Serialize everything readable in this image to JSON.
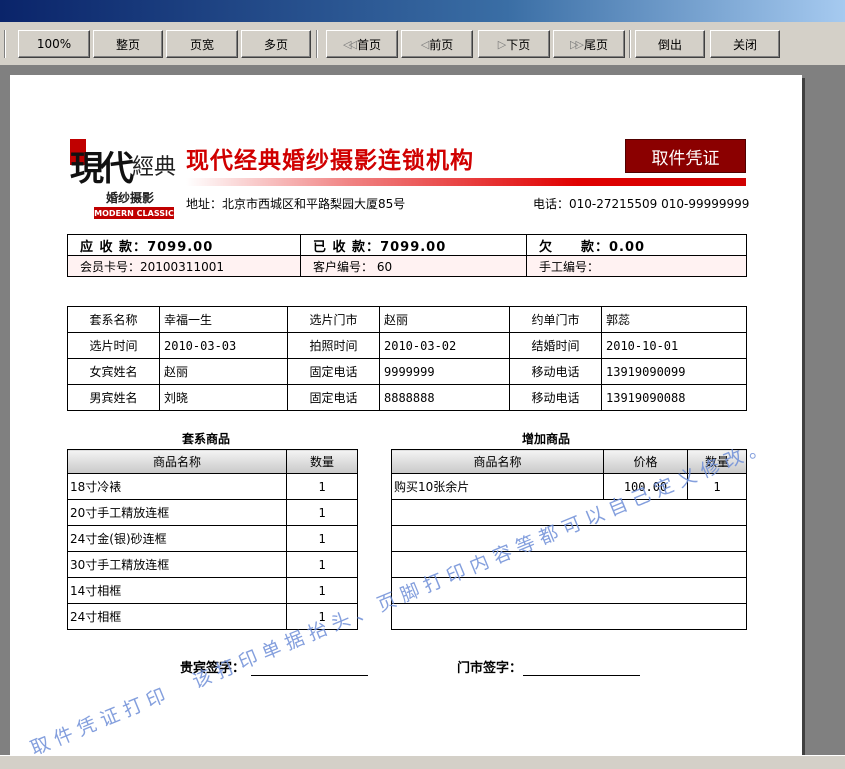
{
  "toolbar": {
    "buttons": [
      "100%",
      "整页",
      "页宽",
      "多页",
      "首页",
      "前页",
      "下页",
      "尾页",
      "倒出",
      "关闭"
    ]
  },
  "slip": {
    "logo_text": "婚纱摄影",
    "logo_sub": "MODERN CLASSIC",
    "company": "现代经典婚纱摄影连锁机构",
    "badge": "取件凭证",
    "address": "地址：北京市西城区和平路梨园大厦85号",
    "phone": "电话：010-27215509 010-99999999"
  },
  "summary": {
    "receivable_label": "应 收 款：",
    "receivable_value": "7099.00",
    "received_label": "已 收 款：",
    "received_value": "7099.00",
    "owed_label": "欠　　款：",
    "owed_value": "0.00",
    "member_card": "会员卡号：20100311001",
    "customer_no": "客户编号： 60",
    "manual_no": "手工编号："
  },
  "info": {
    "rows": [
      [
        "套系名称",
        "幸福一生",
        "选片门市",
        "赵丽",
        "约单门市",
        "郭蕊"
      ],
      [
        "选片时间",
        "2010-03-03",
        "拍照时间",
        "2010-03-02",
        "结婚时间",
        "2010-10-01"
      ],
      [
        "女宾姓名",
        "赵丽",
        "固定电话",
        "9999999",
        "移动电话",
        "13919090099"
      ],
      [
        "男宾姓名",
        "刘晓",
        "固定电话",
        "8888888",
        "移动电话",
        "13919090088"
      ]
    ]
  },
  "package_goods": {
    "title": "套系商品",
    "headers": [
      "商品名称",
      "数量"
    ],
    "rows": [
      [
        "18寸冷裱",
        "1"
      ],
      [
        "20寸手工精放连框",
        "1"
      ],
      [
        "24寸金(银)砂连框",
        "1"
      ],
      [
        "30寸手工精放连框",
        "1"
      ],
      [
        "14寸相框",
        "1"
      ],
      [
        "24寸相框",
        "1"
      ]
    ]
  },
  "extra_goods": {
    "title": "增加商品",
    "headers": [
      "商品名称",
      "价格",
      "数量"
    ],
    "rows": [
      [
        "购买10张余片",
        "100.00",
        "1"
      ],
      [
        "",
        "",
        ""
      ],
      [
        "",
        "",
        ""
      ],
      [
        "",
        "",
        ""
      ],
      [
        "",
        "",
        ""
      ],
      [
        "",
        "",
        ""
      ]
    ]
  },
  "signatures": {
    "guest": "贵宾签字：",
    "store": "门市签字："
  },
  "watermark": "取件凭证打印　该打印单据抬头、页脚打印内容等都可以自己定义修改。"
}
